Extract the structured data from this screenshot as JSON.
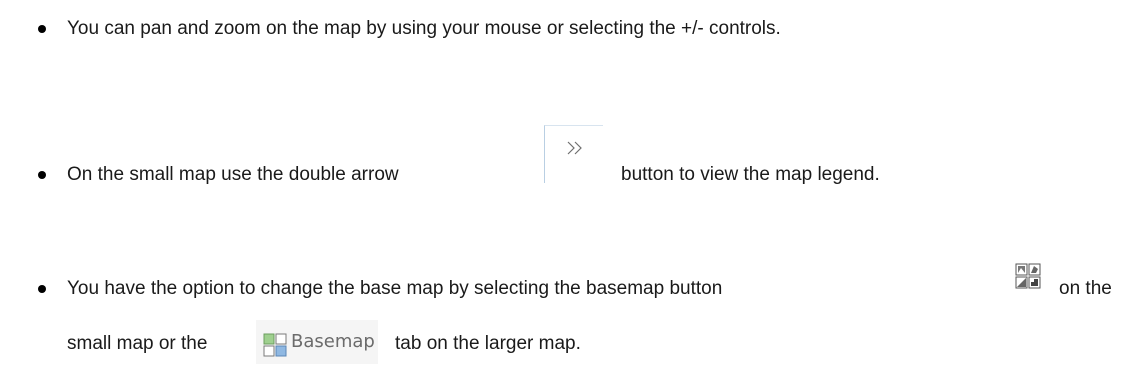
{
  "instructions": {
    "item1": {
      "text": "You can pan and zoom on the map by using your mouse or selecting the +/- controls."
    },
    "item2": {
      "before": "On the small map use the double arrow",
      "after": "button to view the map legend.",
      "button_icon": "double-chevron-right-icon"
    },
    "item3": {
      "line1_before": "You have the option to change the base map by selecting the basemap button",
      "line1_after": "on the",
      "line2_before": "small map or the",
      "line2_after": "tab on the larger map.",
      "basemap_icon": "basemap-grid-icon",
      "tab_label": "Basemap",
      "tab_icon": "basemap-tab-grid-icon"
    }
  },
  "colors": {
    "text": "#1a1a1a",
    "bullet": "#000000",
    "tab_icon_green": "#7bbf6a",
    "tab_icon_blue": "#5b9bd5",
    "tab_label": "#6b6b6b"
  }
}
